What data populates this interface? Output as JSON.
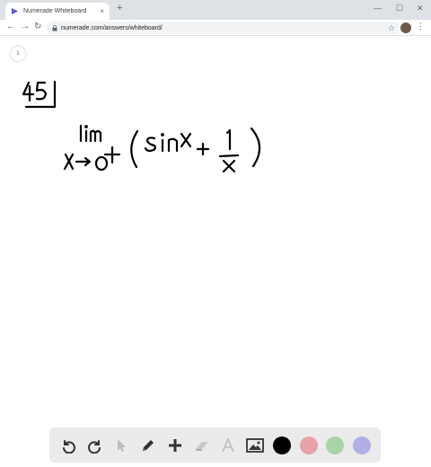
{
  "browser": {
    "tab_title": "Numerade Whiteboard",
    "tab_close": "×",
    "new_tab": "+",
    "url": "numerade.com/answers/whiteboard/",
    "minimize": "—",
    "maximize": "☐",
    "close": "✕",
    "back": "←",
    "forward": "→",
    "reload": "↻",
    "star": "☆",
    "menu": "⋮"
  },
  "whiteboard": {
    "page_number": "1",
    "handwriting": {
      "problem": "45",
      "expression": "lim x→0+ ( sin x + 1/x )"
    },
    "colors": [
      "#000000",
      "#e8a3a8",
      "#a8d5a8",
      "#b0b0e8"
    ],
    "tools": [
      "undo-icon",
      "redo-icon",
      "select-arrow-icon",
      "pen-icon",
      "add-icon",
      "eraser-icon",
      "text-icon",
      "image-icon"
    ]
  }
}
